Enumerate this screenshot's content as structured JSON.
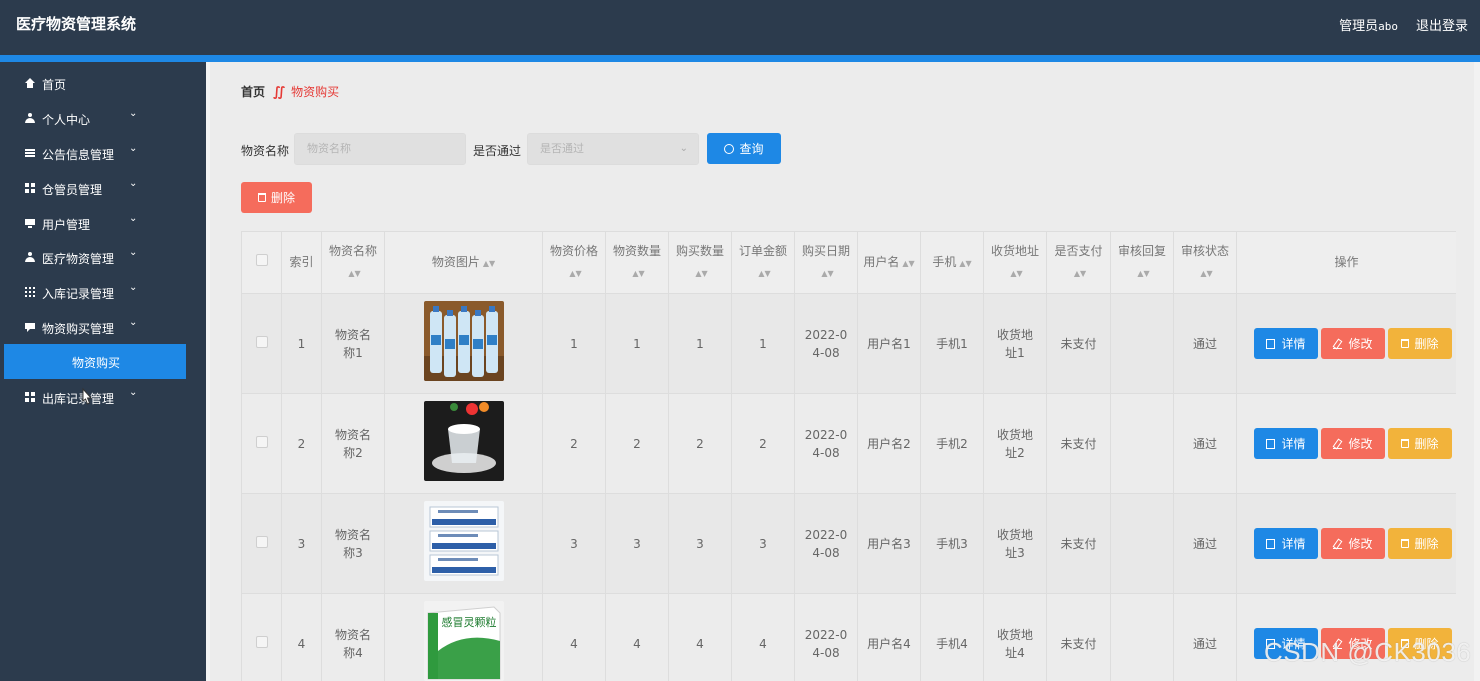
{
  "header": {
    "title": "医疗物资管理系统",
    "role_label": "管理员",
    "username": "abo",
    "logout_label": "退出登录"
  },
  "sidebar": {
    "items": [
      {
        "label": "首页",
        "icon": "home-icon",
        "has_caret": false
      },
      {
        "label": "个人中心",
        "icon": "user-icon",
        "has_caret": true
      },
      {
        "label": "公告信息管理",
        "icon": "list-icon",
        "has_caret": true
      },
      {
        "label": "仓管员管理",
        "icon": "grid-icon",
        "has_caret": true
      },
      {
        "label": "用户管理",
        "icon": "monitor-icon",
        "has_caret": true
      },
      {
        "label": "医疗物资管理",
        "icon": "user-icon",
        "has_caret": true
      },
      {
        "label": "入库记录管理",
        "icon": "grid9-icon",
        "has_caret": true
      },
      {
        "label": "物资购买管理",
        "icon": "chat-icon",
        "has_caret": true
      },
      {
        "label": "出库记录管理",
        "icon": "grid-icon",
        "has_caret": true
      }
    ],
    "active_sub_label": "物资购买"
  },
  "breadcrumb": {
    "home": "首页",
    "separator": "∬",
    "current": "物资购买"
  },
  "search": {
    "name_label": "物资名称",
    "name_placeholder": "物资名称",
    "pass_label": "是否通过",
    "pass_placeholder": "是否通过",
    "query_label": "查询"
  },
  "toolbar": {
    "delete_label": "删除"
  },
  "table": {
    "headers": [
      "索引",
      "物资名称",
      "物资图片",
      "物资价格",
      "物资数量",
      "购买数量",
      "订单金额",
      "购买日期",
      "用户名",
      "手机",
      "收货地址",
      "是否支付",
      "审核回复",
      "审核状态",
      "操作"
    ],
    "rows": [
      {
        "index": "1",
        "name": "物资名称1",
        "price": "1",
        "qty": "1",
        "buy_qty": "1",
        "amount": "1",
        "date": "2022-04-08",
        "user": "用户名1",
        "phone": "手机1",
        "address": "收货地址1",
        "paid": "未支付",
        "reply": "",
        "status": "通过",
        "image": "water-bottles"
      },
      {
        "index": "2",
        "name": "物资名称2",
        "price": "2",
        "qty": "2",
        "buy_qty": "2",
        "amount": "2",
        "date": "2022-04-08",
        "user": "用户名2",
        "phone": "手机2",
        "address": "收货地址2",
        "paid": "未支付",
        "reply": "",
        "status": "通过",
        "image": "glass-cup"
      },
      {
        "index": "3",
        "name": "物资名称3",
        "price": "3",
        "qty": "3",
        "buy_qty": "3",
        "amount": "3",
        "date": "2022-04-08",
        "user": "用户名3",
        "phone": "手机3",
        "address": "收货地址3",
        "paid": "未支付",
        "reply": "",
        "status": "通过",
        "image": "medicine-packs"
      },
      {
        "index": "4",
        "name": "物资名称4",
        "price": "4",
        "qty": "4",
        "buy_qty": "4",
        "amount": "4",
        "date": "2022-04-08",
        "user": "用户名4",
        "phone": "手机4",
        "address": "收货地址4",
        "paid": "未支付",
        "reply": "",
        "status": "通过",
        "image": "cold-granules-box"
      }
    ],
    "action_labels": {
      "detail": "详情",
      "edit": "修改",
      "delete": "删除"
    },
    "image_text_4": "感冒灵颗粒"
  },
  "watermark": "CSDN @CK3036",
  "colors": {
    "header_bg": "#2c3b4d",
    "accent": "#1e88e5",
    "danger": "#f56c5c",
    "warning": "#f2b33b",
    "breadcrumb_active": "#e53935"
  }
}
